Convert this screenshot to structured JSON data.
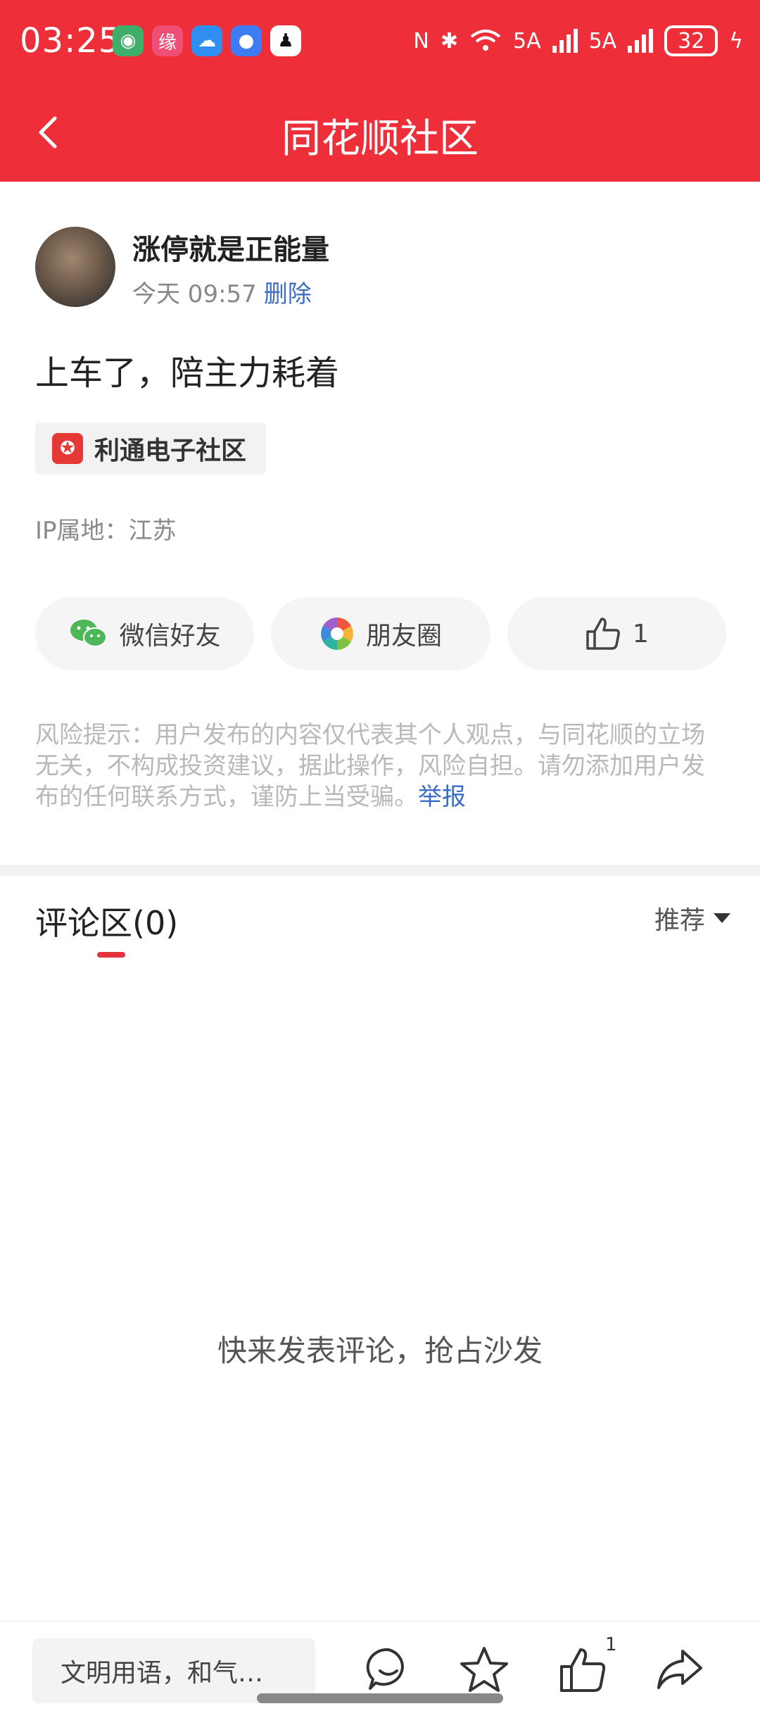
{
  "status_bar": {
    "time": "03:25",
    "signal1": "5A",
    "signal2": "5A",
    "battery": "32"
  },
  "nav": {
    "title": "同花顺社区"
  },
  "post": {
    "username": "涨停就是正能量",
    "time": "今天 09:57",
    "delete_label": "删除",
    "content": "上车了，陪主力耗着",
    "tag": "利通电子社区",
    "ip_location": "IP属地：江苏"
  },
  "share": {
    "wechat_label": "微信好友",
    "moments_label": "朋友圈",
    "like_count": "1"
  },
  "risk": {
    "text": "风险提示：用户发布的内容仅代表其个人观点，与同花顺的立场无关，不构成投资建议，据此操作，风险自担。请勿添加用户发布的任何联系方式，谨防上当受骗。",
    "report_label": "举报"
  },
  "comments": {
    "title": "评论区(0)",
    "sort_label": "推荐",
    "empty_text": "快来发表评论，抢占沙发"
  },
  "bottom": {
    "input_placeholder": "文明用语，和气…",
    "like_badge": "1"
  },
  "colors": {
    "brand_red": "#ee2f3a",
    "link_blue": "#3d6cc8"
  }
}
